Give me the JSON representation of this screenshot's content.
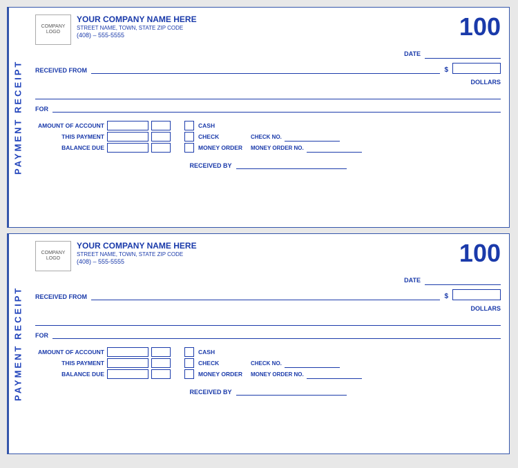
{
  "receipts": [
    {
      "id": "receipt-1",
      "side_label": "PAYMENT RECEIPT",
      "logo_line1": "COMPANY",
      "logo_line2": "LOGO",
      "company_name": "YOUR COMPANY NAME HERE",
      "company_address": "STREET NAME, TOWN, STATE  ZIP CODE",
      "company_phone": "(408) – 555-5555",
      "receipt_number": "100",
      "date_label": "DATE",
      "received_from_label": "RECEIVED FROM",
      "dollar_sign": "$",
      "dollars_label": "DOLLARS",
      "for_label": "FOR",
      "account_rows": [
        {
          "label": "AMOUNT OF ACCOUNT"
        },
        {
          "label": "THIS PAYMENT"
        },
        {
          "label": "BALANCE DUE"
        }
      ],
      "payment_methods": [
        {
          "label": "CASH",
          "extra_label": "",
          "has_extra": false
        },
        {
          "label": "CHECK",
          "extra_label": "CHECK NO.",
          "has_extra": true
        },
        {
          "label": "MONEY ORDER",
          "extra_label": "MONEY ORDER NO.",
          "has_extra": true
        }
      ],
      "received_by_label": "RECEIVED BY"
    },
    {
      "id": "receipt-2",
      "side_label": "PAYMENT RECEIPT",
      "logo_line1": "COMPANY",
      "logo_line2": "LOGO",
      "company_name": "YOUR COMPANY NAME HERE",
      "company_address": "STREET NAME, TOWN, STATE  ZIP CODE",
      "company_phone": "(408) – 555-5555",
      "receipt_number": "100",
      "date_label": "DATE",
      "received_from_label": "RECEIVED FROM",
      "dollar_sign": "$",
      "dollars_label": "DOLLARS",
      "for_label": "FOR",
      "account_rows": [
        {
          "label": "AMOUNT OF ACCOUNT"
        },
        {
          "label": "THIS PAYMENT"
        },
        {
          "label": "BALANCE DUE"
        }
      ],
      "payment_methods": [
        {
          "label": "CASH",
          "extra_label": "",
          "has_extra": false
        },
        {
          "label": "CHECK",
          "extra_label": "CHECK NO.",
          "has_extra": true
        },
        {
          "label": "MONEY ORDER",
          "extra_label": "MONEY ORDER NO.",
          "has_extra": true
        }
      ],
      "received_by_label": "RECEIVED BY"
    }
  ]
}
